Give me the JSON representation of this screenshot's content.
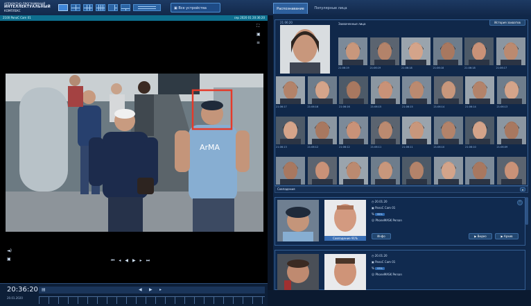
{
  "header": {
    "logo_line1": "АППАРАТНО-ПРОГРАММНЫЙ",
    "logo_line2": "ИНТЕЛЛЕКТУАЛЬНЫЙ",
    "logo_line3": "КОМПЛЕКС",
    "layout_icons": [
      "layout-1x1-icon",
      "layout-2x2-icon",
      "layout-3x3-icon",
      "layout-4x4-icon",
      "layout-1plus5-icon",
      "layout-1plus7-icon",
      "layout-custom-icon"
    ],
    "all_cameras_label": "Все устройства",
    "tabs": [
      "Распознавание",
      "Популярные лица"
    ]
  },
  "video": {
    "camera_title": "2100 PanoC Cam 01",
    "camera_timestamp": "сер 2020 01 20:36:20",
    "controls": [
      "skip-back-icon",
      "prev-frame-icon",
      "play-back-icon",
      "play-icon",
      "next-frame-icon",
      "skip-forward-icon"
    ]
  },
  "timeline": {
    "time": "20:36:20",
    "date": "20.01.2020"
  },
  "recognition": {
    "section_title": "Захваченные лица",
    "clear_button": "История захватов",
    "timestamps": [
      "21:06:20",
      "21:06:19",
      "21:06:19",
      "21:06:18",
      "21:06:18",
      "21:06:18",
      "21:06:17",
      "21:06:17",
      "21:06:16",
      "21:06:16",
      "21:06:15",
      "21:06:15",
      "21:06:14",
      "21:06:14",
      "21:06:13",
      "21:06:13",
      "21:06:12",
      "21:06:12",
      "21:06:11",
      "21:06:11",
      "21:06:10",
      "21:06:10",
      "21:06:09",
      "21:06:09",
      "21:06:08",
      "21:06:08",
      "21:06:07",
      "21:06:07",
      "21:06:06",
      "21:06:06",
      "21:06:05",
      "21:06:05"
    ]
  },
  "matches": {
    "section_title": "Совпадения",
    "items": [
      {
        "time": "20.01.20",
        "camera": "PanoC Cam 01",
        "similarity": "95%",
        "list": "PhoneMASK Person",
        "label": "Совпадение 91%",
        "action_info": "Инфо",
        "action_video": "Видео",
        "action_archive": "Архив"
      },
      {
        "time": "20.01.20",
        "camera": "PanoC Cam 01",
        "similarity": "93%",
        "list": "PhoneMASK Person"
      }
    ]
  }
}
